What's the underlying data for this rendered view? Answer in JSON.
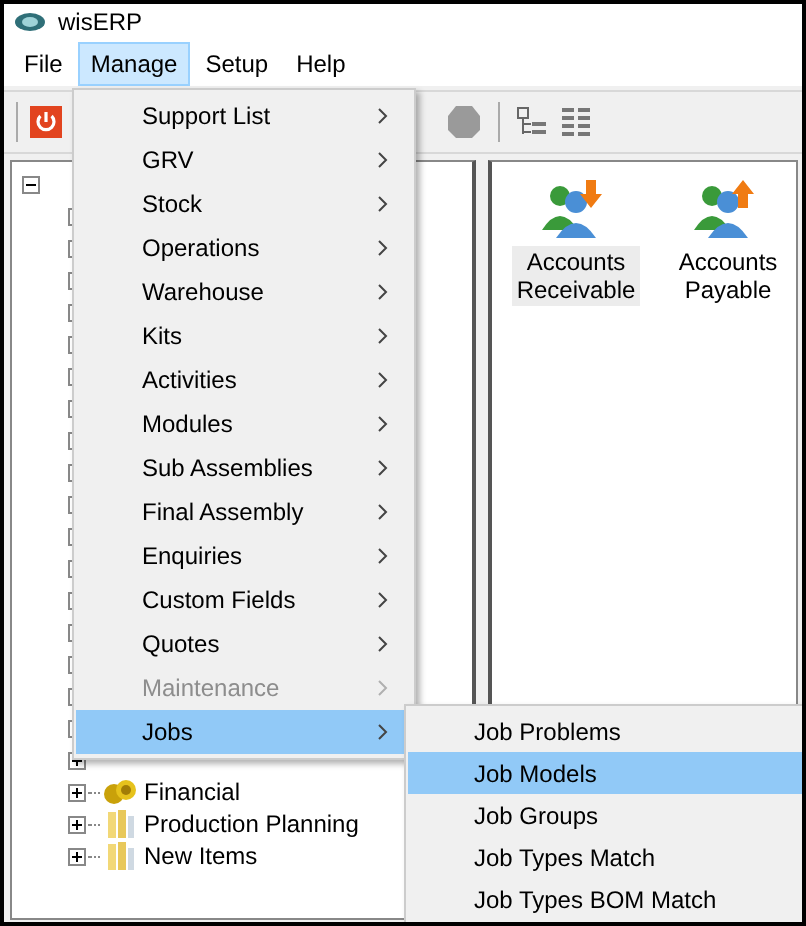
{
  "window": {
    "title": "wisERP"
  },
  "menu_bar": [
    {
      "label": "File",
      "selected": false
    },
    {
      "label": "Manage",
      "selected": true
    },
    {
      "label": "Setup",
      "selected": false
    },
    {
      "label": "Help",
      "selected": false
    }
  ],
  "manage_menu": [
    {
      "label": "Support List",
      "disabled": false,
      "selected": false
    },
    {
      "label": "GRV",
      "disabled": false,
      "selected": false
    },
    {
      "label": "Stock",
      "disabled": false,
      "selected": false
    },
    {
      "label": "Operations",
      "disabled": false,
      "selected": false
    },
    {
      "label": "Warehouse",
      "disabled": false,
      "selected": false
    },
    {
      "label": "Kits",
      "disabled": false,
      "selected": false
    },
    {
      "label": "Activities",
      "disabled": false,
      "selected": false
    },
    {
      "label": "Modules",
      "disabled": false,
      "selected": false
    },
    {
      "label": "Sub Assemblies",
      "disabled": false,
      "selected": false
    },
    {
      "label": "Final Assembly",
      "disabled": false,
      "selected": false
    },
    {
      "label": "Enquiries",
      "disabled": false,
      "selected": false
    },
    {
      "label": "Custom Fields",
      "disabled": false,
      "selected": false
    },
    {
      "label": "Quotes",
      "disabled": false,
      "selected": false
    },
    {
      "label": "Maintenance",
      "disabled": true,
      "selected": false
    },
    {
      "label": "Jobs",
      "disabled": false,
      "selected": true
    }
  ],
  "jobs_submenu": [
    {
      "label": "Job Problems",
      "selected": false
    },
    {
      "label": "Job Models",
      "selected": true
    },
    {
      "label": "Job Groups",
      "selected": false
    },
    {
      "label": "Job Types Match",
      "selected": false
    },
    {
      "label": "Job Types BOM Match",
      "selected": false
    }
  ],
  "tree": {
    "root_expanded": true,
    "items": [
      {
        "label": "Financial",
        "expanded": false,
        "kind": "coins"
      },
      {
        "label": "Production Planning",
        "expanded": false,
        "kind": "folder"
      },
      {
        "label": "New Items",
        "expanded": false,
        "kind": "folder"
      }
    ]
  },
  "shortcuts": [
    {
      "label": "Accounts Receivable",
      "selected": true,
      "kind": "receivable"
    },
    {
      "label": "Accounts Payable",
      "selected": false,
      "kind": "payable"
    }
  ]
}
